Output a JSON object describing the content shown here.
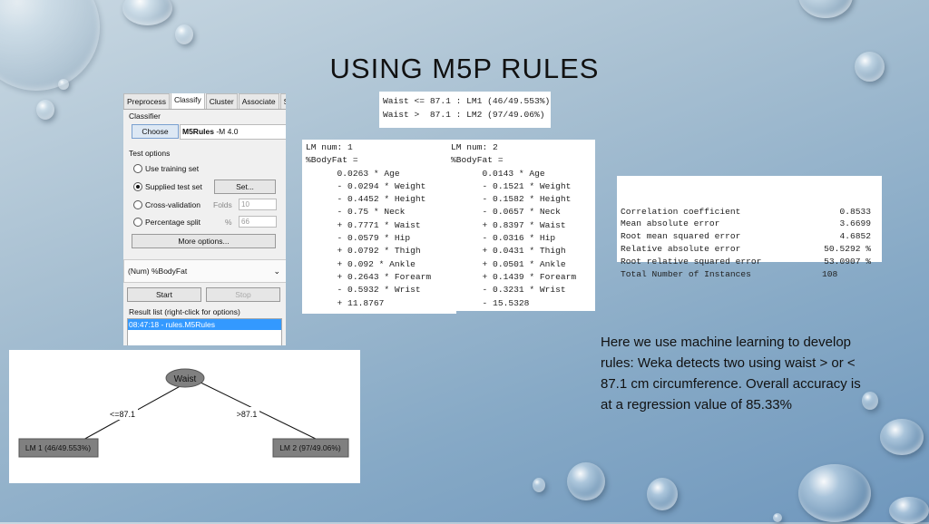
{
  "slide": {
    "title": "USING M5P RULES"
  },
  "weka": {
    "tabs": [
      "Preprocess",
      "Classify",
      "Cluster",
      "Associate",
      "S"
    ],
    "classifier_heading": "Classifier",
    "choose_label": "Choose",
    "classifier_name": "M5Rules",
    "classifier_args": " -M 4.0",
    "test_options_heading": "Test options",
    "use_training_set": "Use training set",
    "supplied_test_set": "Supplied test set",
    "set_label": "Set...",
    "cross_validation": "Cross-validation",
    "folds_label": "Folds",
    "folds_value": "10",
    "percentage_split": "Percentage split",
    "percent_label": "%",
    "percent_value": "66",
    "more_options": "More options...",
    "target_select": "(Num) %BodyFat",
    "start_label": "Start",
    "stop_label": "Stop",
    "result_list_heading": "Result list (right-click for options)",
    "result_item": "08:47:18 - rules.M5Rules"
  },
  "rules_box": {
    "line1": "Waist <= 87.1 : LM1 (46/49.553%)",
    "line2": "Waist >  87.1 : LM2 (97/49.06%)"
  },
  "lm1": {
    "text": "LM num: 1\n%BodyFat =\n\t0.0263 * Age\n\t- 0.0294 * Weight\n\t- 0.4452 * Height\n\t- 0.75 * Neck\n\t+ 0.7771 * Waist\n\t- 0.0579 * Hip\n\t+ 0.0792 * Thigh\n\t+ 0.092 * Ankle\n\t+ 0.2643 * Forearm\n\t- 0.5932 * Wrist\n\t+ 11.8767"
  },
  "lm2": {
    "text": "LM num: 2\n%BodyFat =\n\t0.0143 * Age\n\t- 0.1521 * Weight\n\t- 0.1582 * Height\n\t- 0.0657 * Neck\n\t+ 0.8397 * Waist\n\t- 0.0316 * Hip\n\t+ 0.0431 * Thigh\n\t+ 0.0501 * Ankle\n\t+ 0.1439 * Forearm\n\t- 0.3231 * Wrist\n\t- 15.5328"
  },
  "stats": {
    "rows": [
      {
        "label": "Correlation coefficient",
        "value": "0.8533"
      },
      {
        "label": "Mean absolute error",
        "value": "3.6699"
      },
      {
        "label": "Root mean squared error",
        "value": "4.6852"
      },
      {
        "label": "Relative absolute error",
        "value": "50.5292 %"
      },
      {
        "label": "Root relative squared error",
        "value": "53.0907 %"
      },
      {
        "label": "Total Number of Instances",
        "value": "108"
      }
    ]
  },
  "tree": {
    "root": "Waist",
    "left_edge": "<=87.1",
    "right_edge": ">87.1",
    "left_leaf": "LM 1 (46/49.553%)",
    "right_leaf": "LM 2 (97/49.06%)"
  },
  "description": "Here we use machine learning to develop rules: Weka detects two using waist > or < 87.1 cm circumference.  Overall accuracy is at a regression value of 85.33%",
  "colors": {
    "selection": "#3399ff",
    "tree_node": "#808080"
  }
}
